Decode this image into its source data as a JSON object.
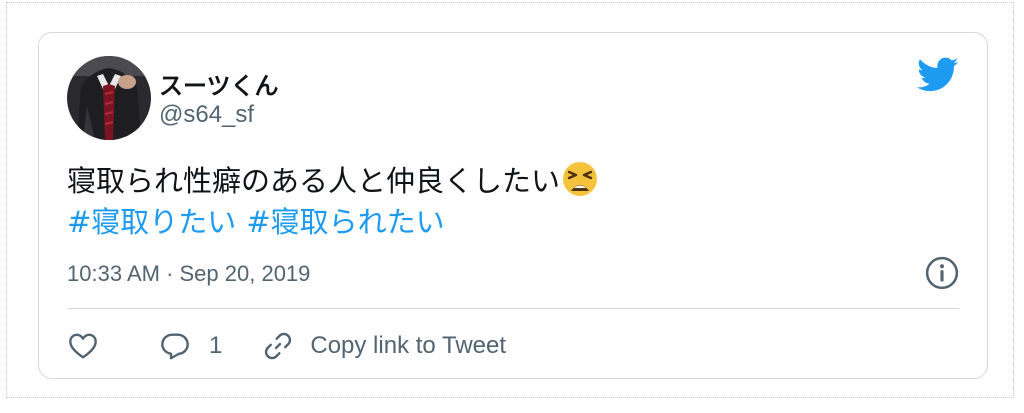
{
  "tweet": {
    "author": {
      "display_name": "スーツくん",
      "handle": "@s64_sf",
      "avatar_icon": "avatar-photo"
    },
    "text": "寝取られ性癖のある人と仲良くしたい",
    "emoji": "tired-face-emoji",
    "hashtags": [
      "#寝取りたい",
      "#寝取られたい"
    ],
    "timestamp": "10:33 AM · Sep 20, 2019",
    "actions": {
      "like_icon": "heart-icon",
      "reply_icon": "reply-icon",
      "reply_count": "1",
      "copy_icon": "link-icon",
      "copy_label": "Copy link to Tweet"
    },
    "brand_icon": "twitter-bird-icon",
    "info_icon": "info-icon"
  },
  "colors": {
    "brand": "#1d9bf0",
    "text": "#0f1419",
    "secondary": "#536471",
    "border": "#cfd9de"
  }
}
